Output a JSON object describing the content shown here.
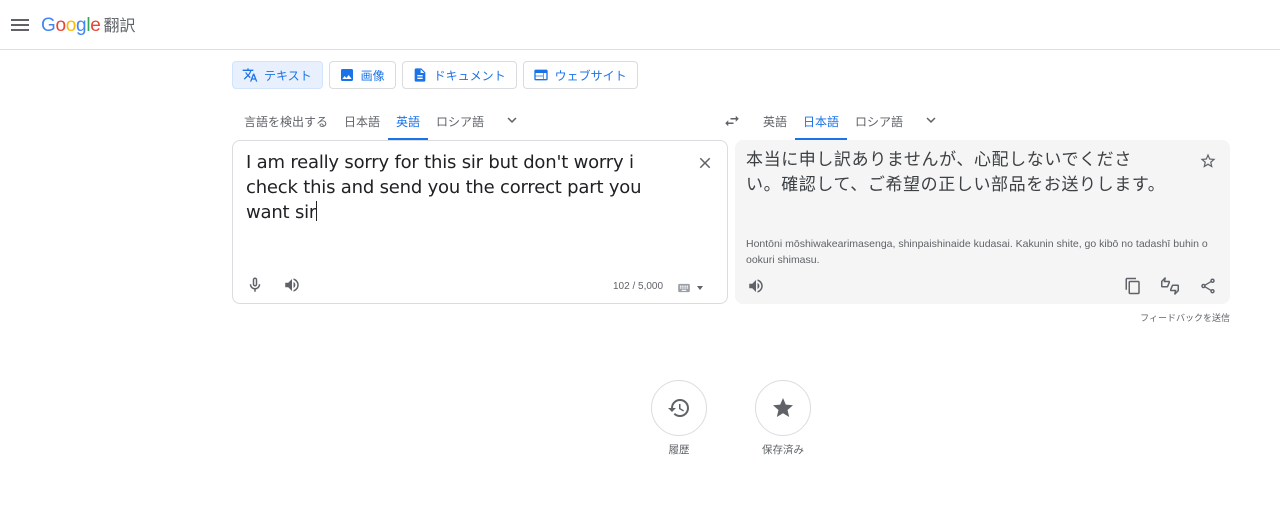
{
  "header": {
    "logo_google": "Google",
    "logo_product": "翻訳",
    "logo_colors": [
      "#4285F4",
      "#EA4335",
      "#FBBC05",
      "#4285F4",
      "#34A853",
      "#EA4335"
    ],
    "menu_icon": "hamburger-menu-icon"
  },
  "modes": [
    {
      "label": "テキスト",
      "icon": "translate-icon",
      "active": true
    },
    {
      "label": "画像",
      "icon": "image-icon",
      "active": false
    },
    {
      "label": "ドキュメント",
      "icon": "document-icon",
      "active": false
    },
    {
      "label": "ウェブサイト",
      "icon": "website-icon",
      "active": false
    }
  ],
  "source_languages": [
    {
      "label": "言語を検出する",
      "active": false
    },
    {
      "label": "日本語",
      "active": false
    },
    {
      "label": "英語",
      "active": true
    },
    {
      "label": "ロシア語",
      "active": false
    }
  ],
  "target_languages": [
    {
      "label": "英語",
      "active": false
    },
    {
      "label": "日本語",
      "active": true
    },
    {
      "label": "ロシア語",
      "active": false
    }
  ],
  "source": {
    "text": "I am really sorry for this sir but don't worry i check this and send you the correct part you want sir",
    "char_count": "102 / 5,000"
  },
  "target": {
    "text": "本当に申し訳ありませんが、心配しないでください。確認して、ご希望の正しい部品をお送りします。",
    "romanized": "Hontōni mōshiwakearimasenga, shinpaishinaide kudasai. Kakunin shite, go kibō no tadashī buhin o ookuri shimasu."
  },
  "feedback_label": "フィードバックを送信",
  "bottom_actions": [
    {
      "label": "履歴",
      "icon": "history-icon"
    },
    {
      "label": "保存済み",
      "icon": "star-icon"
    }
  ],
  "colors": {
    "accent": "#1a73e8",
    "tab_active_bg": "#e8f0fe",
    "target_bg": "#f5f5f5",
    "icon_gray": "#5f6368"
  }
}
